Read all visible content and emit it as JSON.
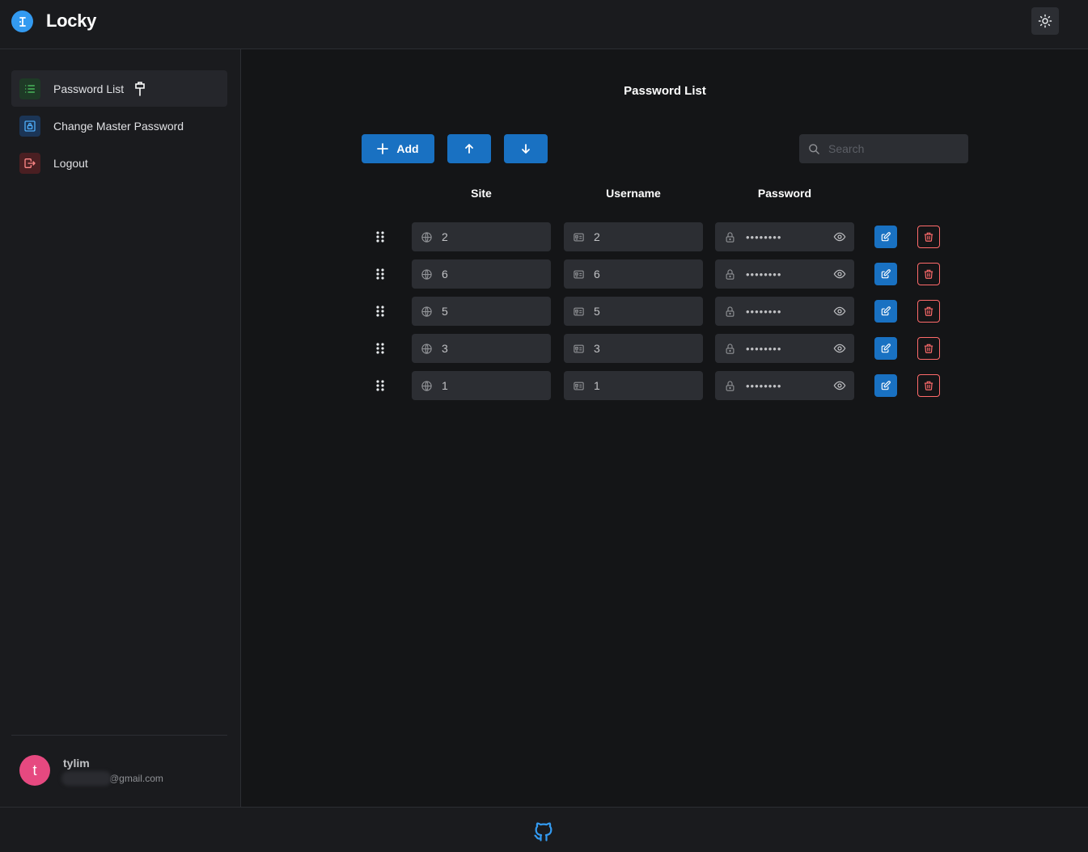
{
  "app": {
    "title": "Locky"
  },
  "header": {
    "theme_toggle_icon": "sun-icon"
  },
  "sidebar": {
    "items": [
      {
        "label": "Password List",
        "icon": "list-icon",
        "color": "#2b8a3e",
        "active": true,
        "extra_icon": "pin-icon"
      },
      {
        "label": "Change Master Password",
        "icon": "lock-square-icon",
        "color": "#1c7ed6",
        "active": false
      },
      {
        "label": "Logout",
        "icon": "logout-icon",
        "color": "#c92a2a",
        "active": false
      }
    ],
    "user": {
      "initial": "t",
      "name": "tylim",
      "email": "@gmail.com"
    }
  },
  "main": {
    "title": "Password List",
    "toolbar": {
      "add_label": "Add",
      "search_placeholder": "Search"
    },
    "columns": [
      "Site",
      "Username",
      "Password"
    ],
    "rows": [
      {
        "site": "2",
        "username": "2",
        "password": "••••••••"
      },
      {
        "site": "6",
        "username": "6",
        "password": "••••••••"
      },
      {
        "site": "5",
        "username": "5",
        "password": "••••••••"
      },
      {
        "site": "3",
        "username": "3",
        "password": "••••••••"
      },
      {
        "site": "1",
        "username": "1",
        "password": "••••••••"
      }
    ]
  },
  "footer": {
    "icon": "github-icon"
  },
  "colors": {
    "accent": "#1971c2",
    "danger": "#ff6b6b",
    "avatar": "#e64980"
  }
}
